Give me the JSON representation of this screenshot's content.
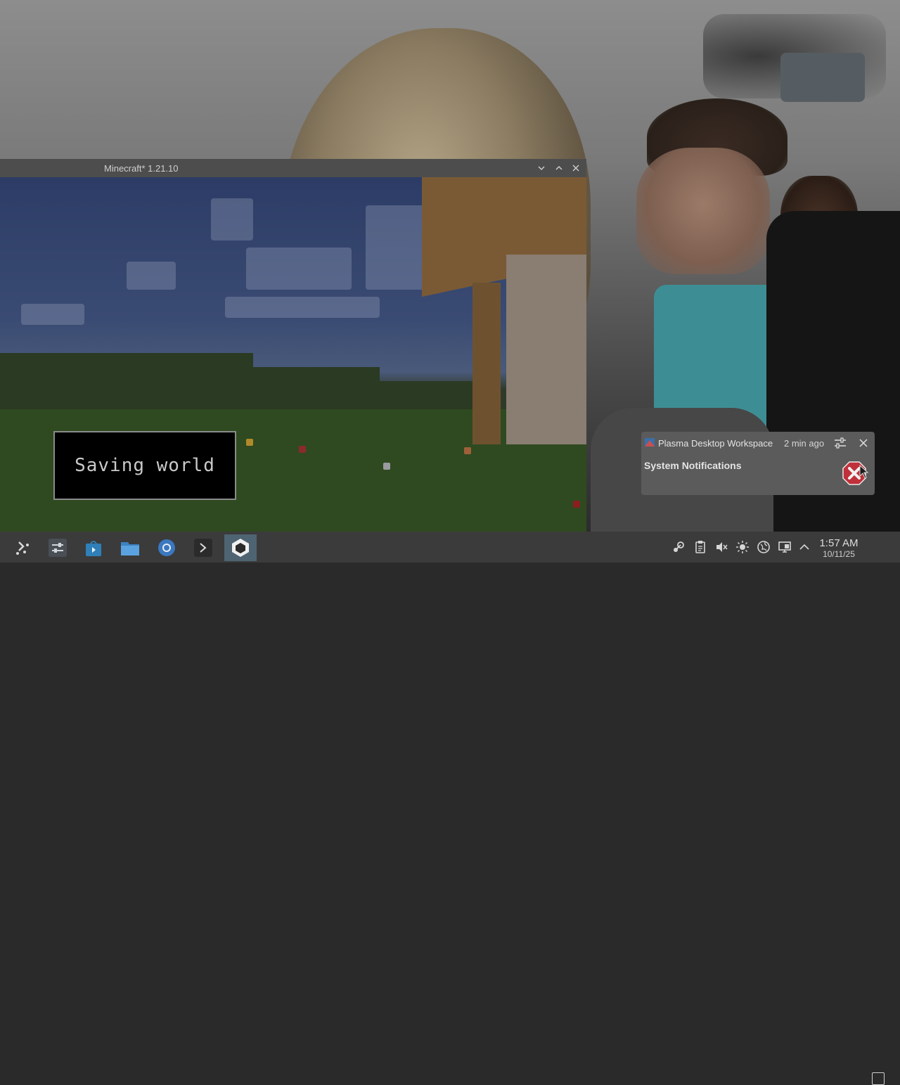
{
  "window": {
    "title": "Minecraft* 1.21.10",
    "minimize_icon": "chevron-down-icon",
    "maximize_icon": "chevron-up-icon",
    "close_icon": "close-icon"
  },
  "game": {
    "overlay_text": "Saving world"
  },
  "notification": {
    "app_name": "Plasma Desktop Workspace",
    "time": "2 min ago",
    "title": "System Notifications",
    "settings_icon": "sliders-icon",
    "close_icon": "close-icon",
    "status_icon": "error-x-icon"
  },
  "taskbar": {
    "items": [
      {
        "name": "application-launcher",
        "icon": "launcher-icon"
      },
      {
        "name": "system-settings",
        "icon": "settings-sliders-icon"
      },
      {
        "name": "discover-store",
        "icon": "store-bag-icon"
      },
      {
        "name": "file-manager",
        "icon": "folder-icon"
      },
      {
        "name": "chromium-browser",
        "icon": "browser-icon"
      },
      {
        "name": "terminal",
        "icon": "terminal-icon"
      },
      {
        "name": "minecraft",
        "icon": "minecraft-launcher-icon",
        "active": true
      }
    ],
    "tray": [
      "steam-icon",
      "clipboard-icon",
      "volume-muted-icon",
      "brightness-icon",
      "network-globe-icon",
      "display-icon",
      "expand-tray-icon"
    ],
    "clock_time": "1:57 AM",
    "clock_date": "10/11/25"
  },
  "colors": {
    "taskbar_bg": "#3b3b3b",
    "notification_bg": "#5b5b5b",
    "active_task": "#4e6472",
    "error_red": "#c0303a"
  }
}
